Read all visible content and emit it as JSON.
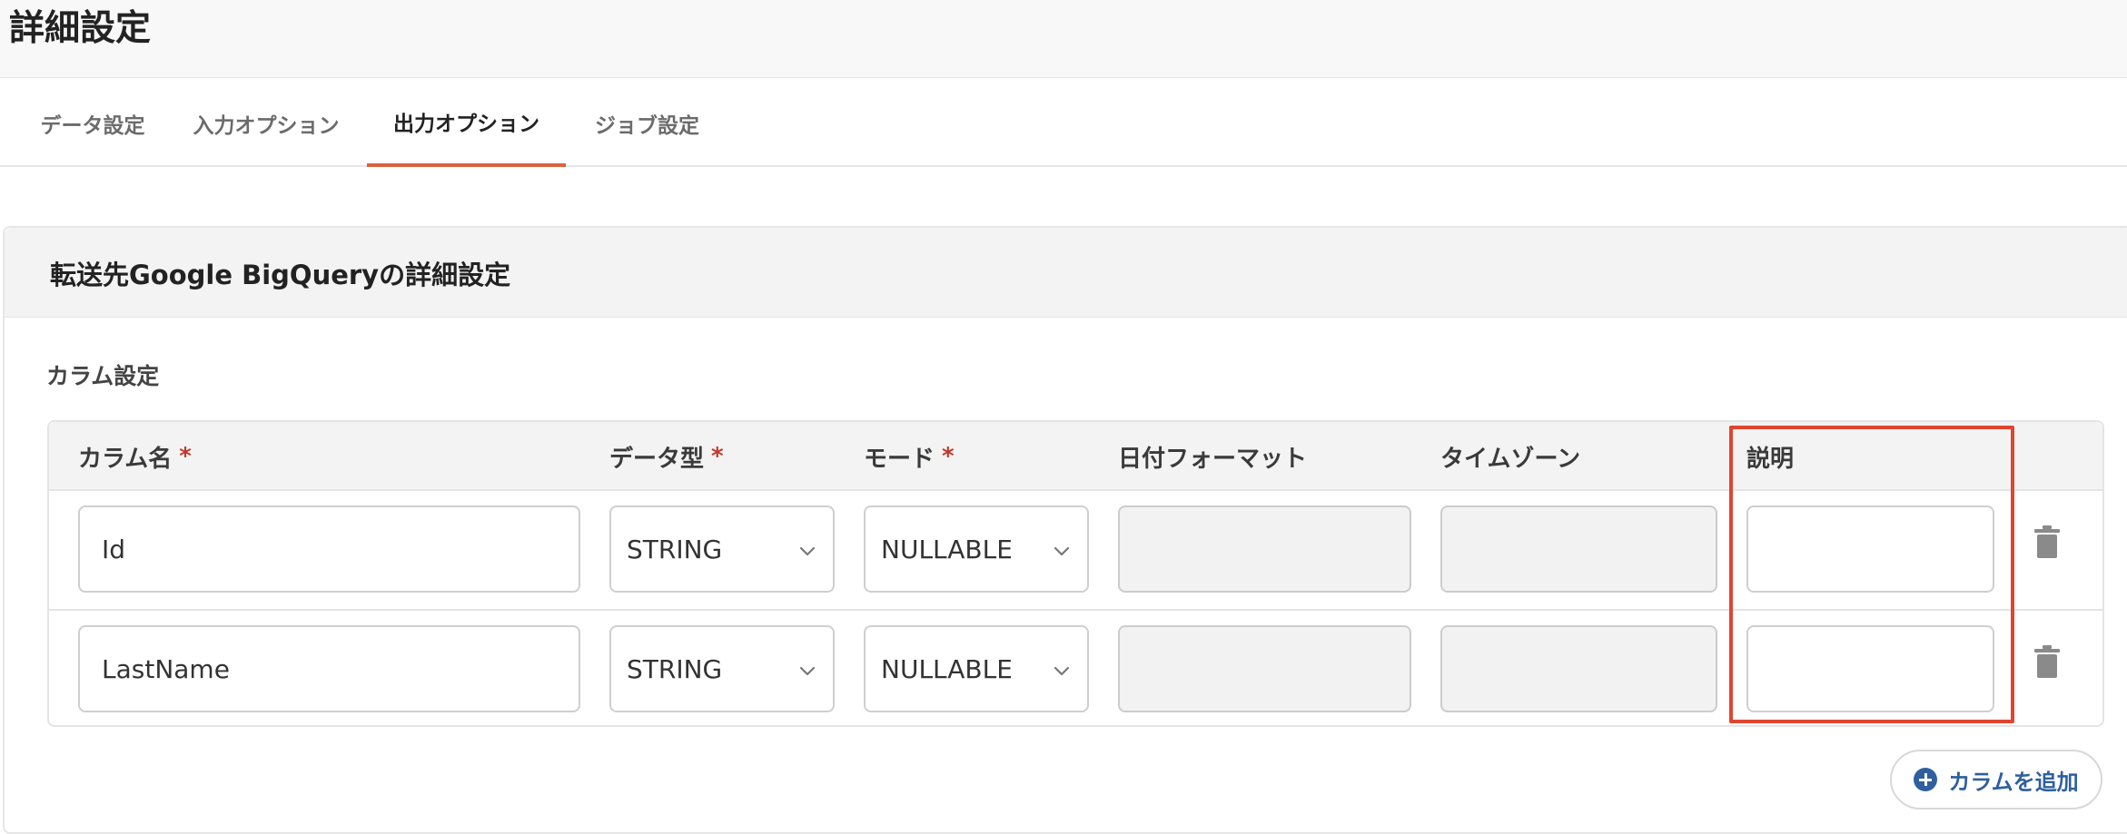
{
  "page": {
    "title": "詳細設定"
  },
  "tabs": [
    {
      "label": "データ設定",
      "active": false
    },
    {
      "label": "入力オプション",
      "active": false
    },
    {
      "label": "出力オプション",
      "active": true
    },
    {
      "label": "ジョブ設定",
      "active": false
    }
  ],
  "panel": {
    "title": "転送先Google BigQueryの詳細設定",
    "section_label": "カラム設定"
  },
  "table": {
    "headers": {
      "name": "カラム名",
      "type": "データ型",
      "mode": "モード",
      "date_format": "日付フォーマット",
      "timezone": "タイムゾーン",
      "description": "説明",
      "required_mark": "*"
    },
    "rows": [
      {
        "name": "Id",
        "type": "STRING",
        "mode": "NULLABLE",
        "date_format": "",
        "timezone": "",
        "description": ""
      },
      {
        "name": "LastName",
        "type": "STRING",
        "mode": "NULLABLE",
        "date_format": "",
        "timezone": "",
        "description": ""
      }
    ]
  },
  "add_button": {
    "label": "カラムを追加",
    "icon": "plus-circle-icon"
  },
  "colors": {
    "accent": "#d9623d",
    "required": "#c0392b",
    "highlight": "#e0452f",
    "link": "#2f5f9e"
  }
}
